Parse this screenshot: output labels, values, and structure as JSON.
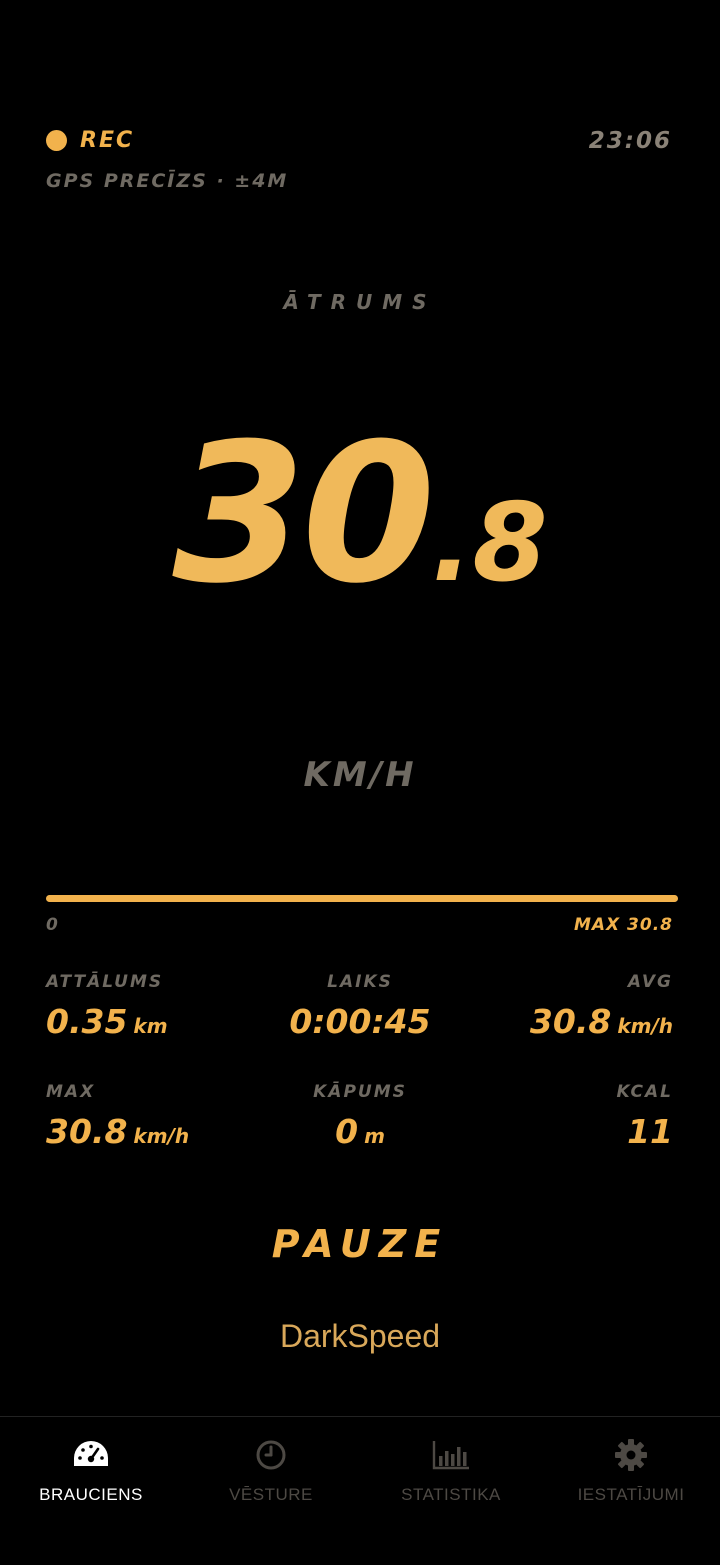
{
  "status": {
    "rec_label": "REC",
    "time": "23:06",
    "gps": "GPS PRECĪZS · ±4M"
  },
  "speed": {
    "label": "ĀTRUMS",
    "integer": "30",
    "decimal": ".8",
    "unit": "KM/H"
  },
  "speed_bar": {
    "min_label": "0",
    "max_label": "MAX 30.8",
    "fill_fraction": 1.0
  },
  "stats": {
    "distance": {
      "label": "ATTĀLUMS",
      "value": "0.35",
      "unit": "km"
    },
    "time": {
      "label": "LAIKS",
      "value": "0:00:45",
      "unit": ""
    },
    "avg": {
      "label": "AVG",
      "value": "30.8",
      "unit": "km/h"
    },
    "max": {
      "label": "MAX",
      "value": "30.8",
      "unit": "km/h"
    },
    "climb": {
      "label": "KĀPUMS",
      "value": "0",
      "unit": "m"
    },
    "kcal": {
      "label": "KCAL",
      "value": "11",
      "unit": ""
    }
  },
  "pause_label": "PAUZE",
  "brand": "DarkSpeed",
  "tabs": [
    {
      "label": "BRAUCIENS",
      "icon": "speedometer-icon",
      "active": true
    },
    {
      "label": "VĒSTURE",
      "icon": "clock-icon",
      "active": false
    },
    {
      "label": "STATISTIKA",
      "icon": "bar-chart-icon",
      "active": false
    },
    {
      "label": "IESTATĪJUMI",
      "icon": "gear-icon",
      "active": false
    }
  ],
  "colors": {
    "accent": "#f2b24c",
    "muted": "#6f6a62",
    "background": "#000000"
  }
}
